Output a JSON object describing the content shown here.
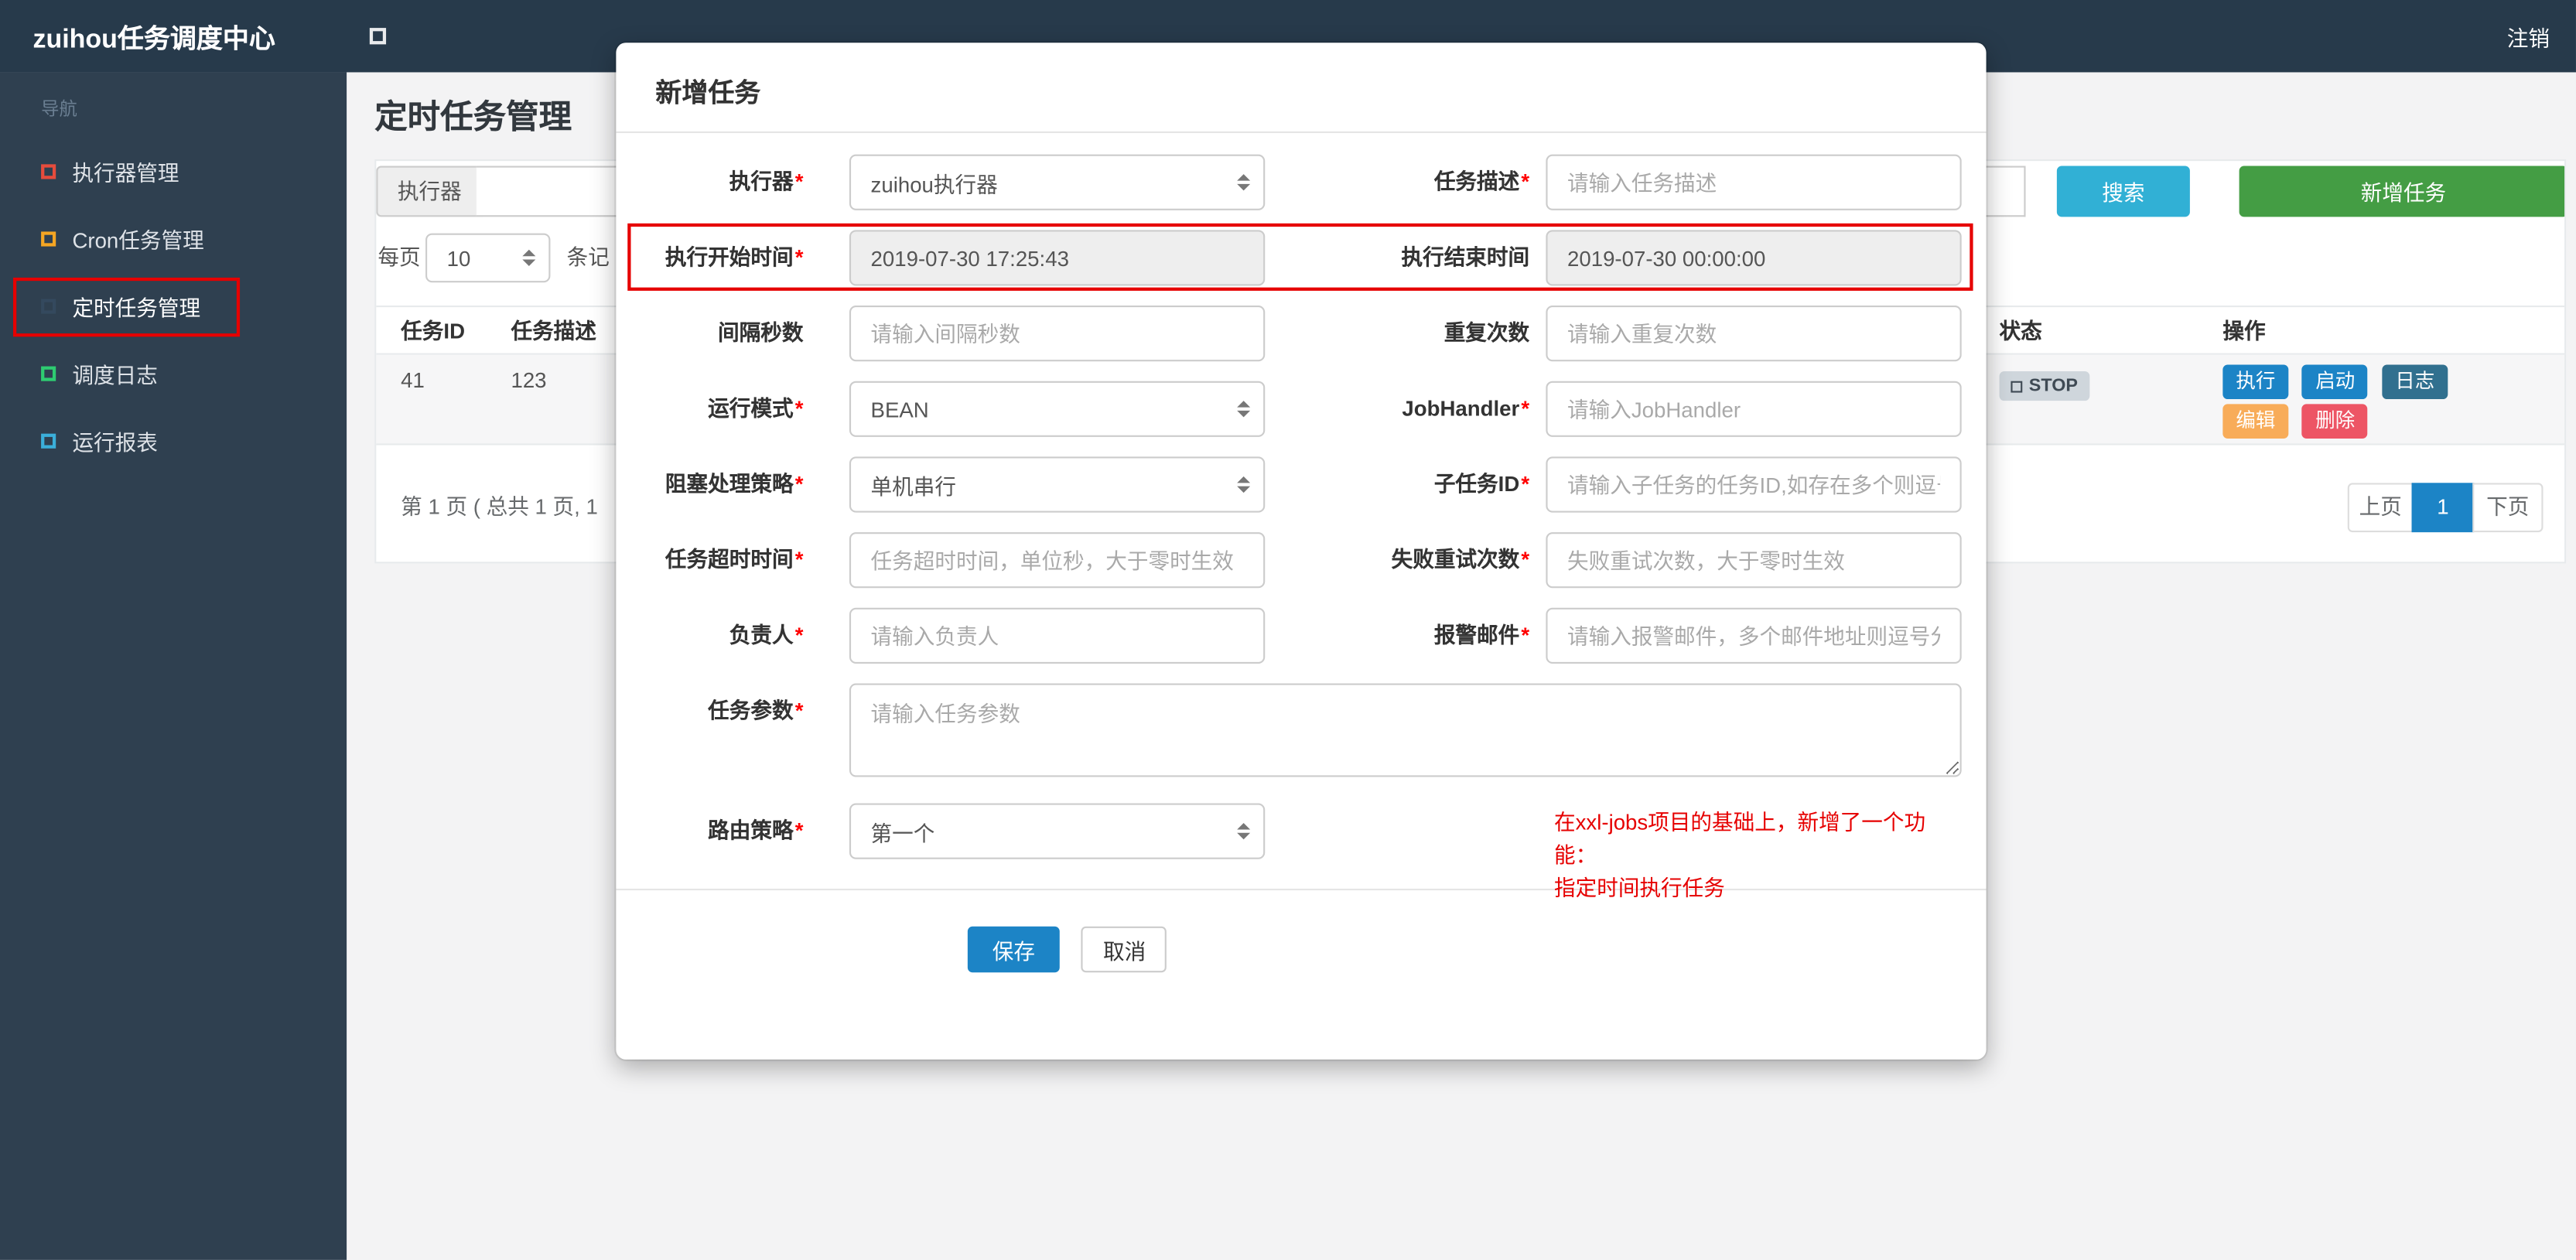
{
  "colors": {
    "topbar-bg": "#273a4b",
    "sidebar-bg": "#2f4050",
    "primary": "#1c84c6",
    "success": "#449d44",
    "info": "#31b0d5",
    "warning": "#f8ac59",
    "danger": "#ed5565",
    "log-btn": "#31708f",
    "annotation-red": "#e60000",
    "note-red": "#e60000",
    "badge-bg": "#cfd6dc"
  },
  "topbar": {
    "brand": "zuihou任务调度中心",
    "logout_label": "注销"
  },
  "sidebar": {
    "nav_header": "导航",
    "items": [
      {
        "label": "执行器管理",
        "icon": "square-outline",
        "icon_color": "#e74c3c",
        "icon_style": "border-color:#e74c3c"
      },
      {
        "label": "Cron任务管理",
        "icon": "square-outline",
        "icon_color": "#f5a623",
        "icon_style": "border-color:#f5a623"
      },
      {
        "label": "定时任务管理",
        "icon": "square-outline",
        "icon_color": "#34495e",
        "icon_style": "border-color:#34495e",
        "active": true
      },
      {
        "label": "调度日志",
        "icon": "square-outline",
        "icon_color": "#2ecc71",
        "icon_style": "border-color:#2ecc71"
      },
      {
        "label": "运行报表",
        "icon": "square-outline",
        "icon_color": "#3bafda",
        "icon_style": "border-color:#3bafda"
      }
    ]
  },
  "page": {
    "title": "定时任务管理",
    "filter": {
      "executor_addon": "执行器",
      "search_label": "搜索",
      "add_label": "新增任务"
    },
    "page_size": {
      "prefix": "每页",
      "value": "10",
      "suffix": "条记"
    },
    "table": {
      "headers": {
        "id": "任务ID",
        "desc": "任务描述",
        "status": "状态",
        "actions": "操作"
      },
      "row": {
        "id": "41",
        "desc": "123",
        "status": "STOP",
        "btn_execute": "执行",
        "btn_start": "启动",
        "btn_log": "日志",
        "btn_edit": "编辑",
        "btn_delete": "删除"
      }
    },
    "pagination": {
      "summary": "第 1 页 ( 总共 1 页, 1",
      "prev": "上页",
      "current": "1",
      "next": "下页"
    }
  },
  "modal": {
    "title": "新增任务",
    "asterisk": "*",
    "rows": [
      {
        "left_label": "执行器",
        "left_value": "zuihou执行器",
        "right_label": "任务描述",
        "right_placeholder": "请输入任务描述"
      },
      {
        "left_label": "执行开始时间",
        "left_value": "2019-07-30 17:25:43",
        "right_label": "执行结束时间",
        "right_value": "2019-07-30 00:00:00"
      },
      {
        "left_label": "间隔秒数",
        "left_placeholder": "请输入间隔秒数",
        "right_label": "重复次数",
        "right_placeholder": "请输入重复次数"
      },
      {
        "left_label": "运行模式",
        "left_value": "BEAN",
        "right_label": "JobHandler",
        "right_placeholder": "请输入JobHandler"
      },
      {
        "left_label": "阻塞处理策略",
        "left_value": "单机串行",
        "right_label": "子任务ID",
        "right_placeholder": "请输入子任务的任务ID,如存在多个则逗号分隔"
      },
      {
        "left_label": "任务超时时间",
        "left_placeholder": "任务超时时间，单位秒，大于零时生效",
        "right_label": "失败重试次数",
        "right_placeholder": "失败重试次数，大于零时生效"
      },
      {
        "left_label": "负责人",
        "left_placeholder": "请输入负责人",
        "right_label": "报警邮件",
        "right_placeholder": "请输入报警邮件，多个邮件地址则逗号分隔"
      }
    ],
    "params_label": "任务参数",
    "params_placeholder": "请输入任务参数",
    "route_label": "路由策略",
    "route_value": "第一个",
    "note_line1": "在xxl-jobs项目的基础上，新增了一个功能：",
    "note_line2": "指定时间执行任务",
    "save_label": "保存",
    "cancel_label": "取消"
  }
}
